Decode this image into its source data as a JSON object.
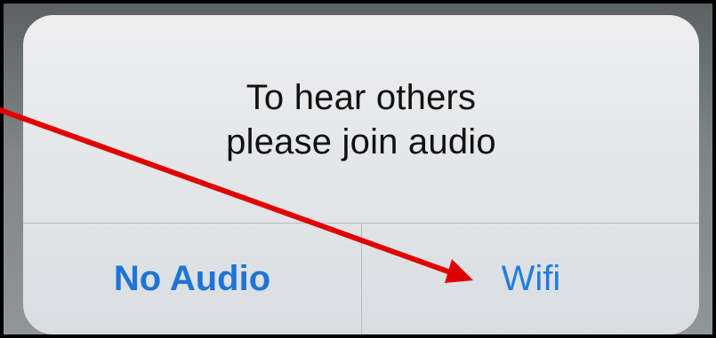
{
  "alert": {
    "message_line_1": "To hear others",
    "message_line_2": "please join audio",
    "buttons": {
      "no_audio": "No Audio",
      "wifi": "Wifi"
    }
  },
  "annotation": {
    "arrow_color": "#e10000"
  },
  "colors": {
    "button_blue": "#1f7ddf",
    "alert_bg": "#e2e4e7",
    "frame": "#000000"
  }
}
